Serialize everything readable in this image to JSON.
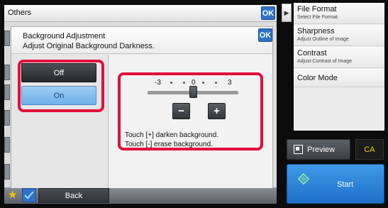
{
  "others": {
    "title": "Others",
    "ok_label": "OK"
  },
  "dialog": {
    "title": "Background Adjustment",
    "subtitle": "Adjust Original Background Darkness.",
    "ok_label": "OK",
    "toggle": {
      "off_label": "Off",
      "on_label": "On",
      "selected": "On"
    },
    "slider": {
      "min_label": "-3",
      "mid_label": "0",
      "max_label": "3",
      "value": 0,
      "min": -3,
      "max": 3,
      "minus_label": "−",
      "plus_label": "+"
    },
    "hints": [
      "Touch [+] darken background.",
      "Touch [-] erase background."
    ]
  },
  "right_menu": {
    "items": [
      {
        "title": "File Format",
        "subtitle": "Select File Format"
      },
      {
        "title": "Sharpness",
        "subtitle": "Adjust Outline of Image"
      },
      {
        "title": "Contrast",
        "subtitle": "Adjust Contrast of Image"
      },
      {
        "title": "Color Mode",
        "subtitle": ""
      }
    ],
    "preview_label": "Preview",
    "ca_label": "CA",
    "start_label": "Start"
  },
  "bottom_bar": {
    "back_label": "Back"
  },
  "colors": {
    "accent": "#2f73c8",
    "highlight": "#e0103b",
    "start": "#2e86dc"
  }
}
